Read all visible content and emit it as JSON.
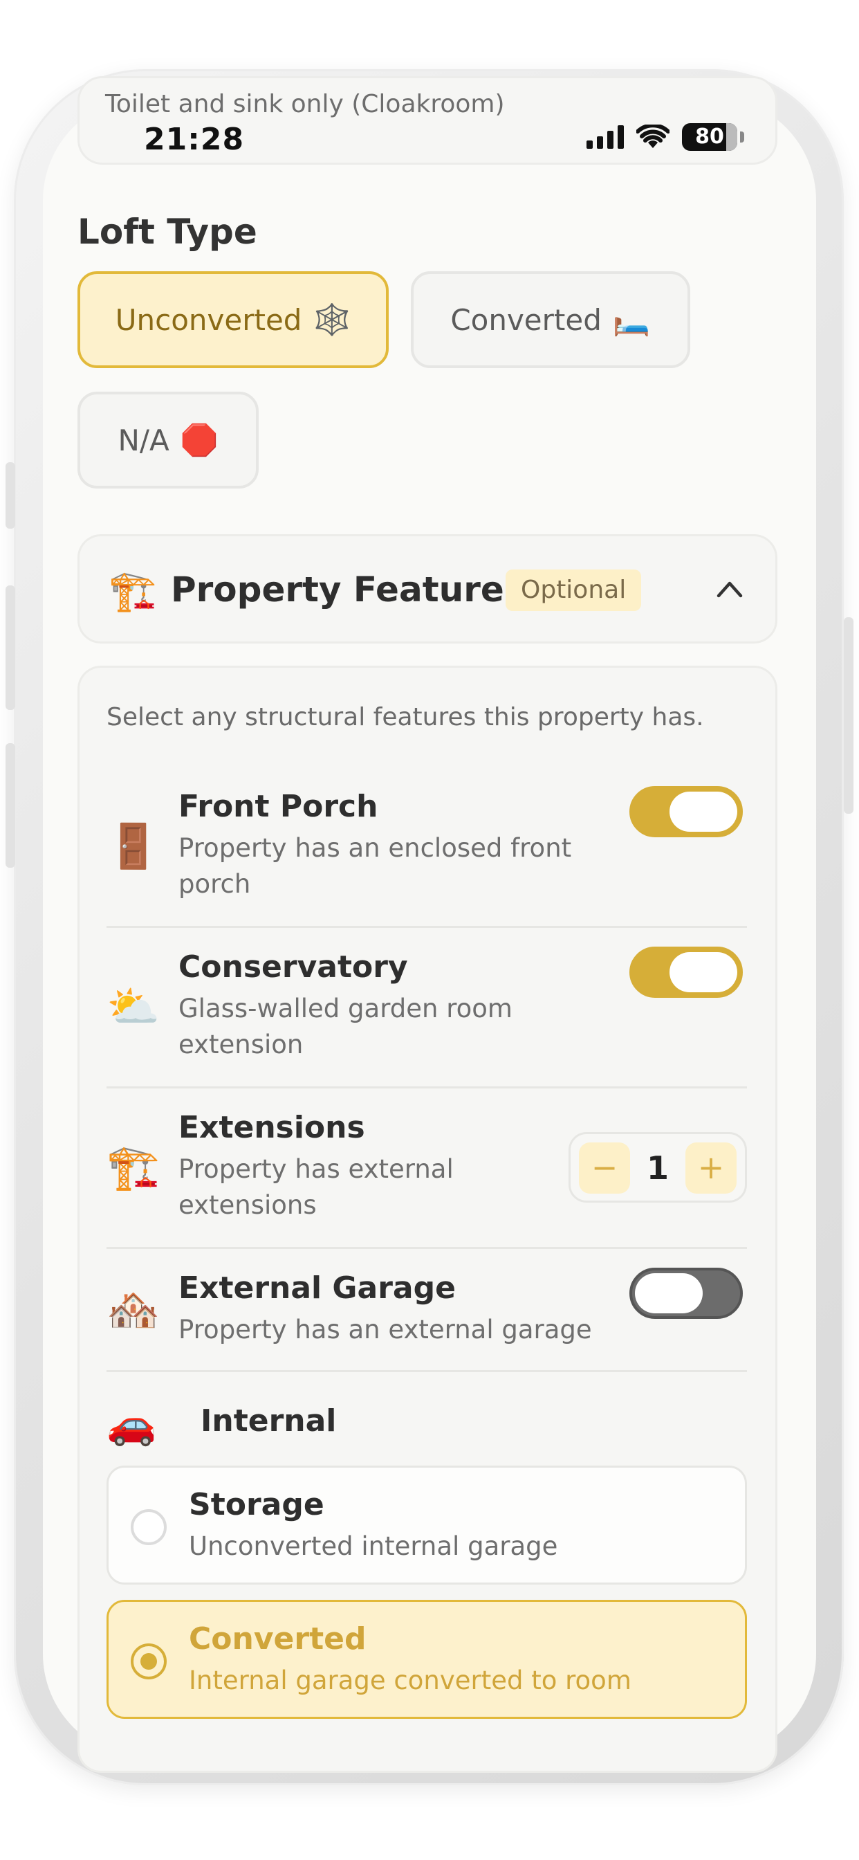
{
  "status_bar": {
    "time": "21:28",
    "battery": "80"
  },
  "previous_option": {
    "label": "Toilet and sink only (Cloakroom)"
  },
  "loft_type": {
    "title": "Loft Type",
    "options": [
      {
        "label": "Unconverted",
        "icon": "🕸️",
        "selected": true
      },
      {
        "label": "Converted",
        "icon": "🛏️",
        "selected": false
      },
      {
        "label": "N/A",
        "icon": "🛑",
        "selected": false
      }
    ]
  },
  "property_features": {
    "icon": "🏗️",
    "title": "Property Features",
    "badge": "Optional",
    "expanded": true,
    "description": "Select any structural features this property has.",
    "features": [
      {
        "icon": "🚪",
        "name": "Front Porch",
        "desc": "Property has an enclosed front porch",
        "control": "toggle",
        "on": true
      },
      {
        "icon": "⛅",
        "name": "Conservatory",
        "desc": "Glass-walled garden room extension",
        "control": "toggle",
        "on": true
      },
      {
        "icon": "🏗️",
        "name": "Extensions",
        "desc": "Property has external extensions",
        "control": "stepper",
        "value": "1",
        "minus": "−",
        "plus": "+"
      },
      {
        "icon": "🏘️",
        "name": "External Garage",
        "desc": "Property has an external garage",
        "control": "toggle",
        "on": false
      }
    ],
    "internal_garage": {
      "icon": "🚗",
      "label": "Internal",
      "options": [
        {
          "title": "Storage",
          "sub": "Unconverted internal garage",
          "selected": false
        },
        {
          "title": "Converted",
          "sub": "Internal garage converted to room",
          "selected": true
        }
      ]
    }
  },
  "colors": {
    "accent": "#d6ae38",
    "accent_bg": "#fdf1cc",
    "toggle_off": "#6c6c6c"
  }
}
